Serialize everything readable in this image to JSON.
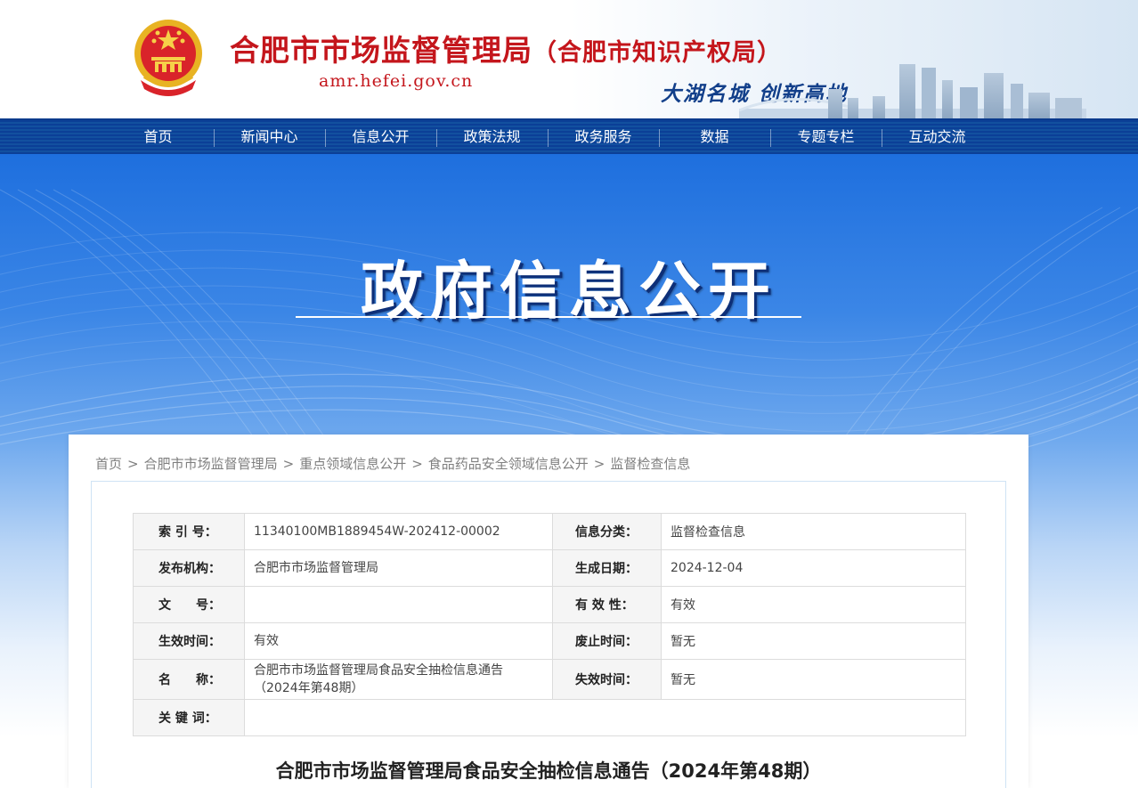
{
  "header": {
    "site_title_main": "合肥市市场监督管理局",
    "site_title_sub": "（合肥市知识产权局）",
    "domain": "amr.hefei.gov.cn",
    "slogan": "大湖名城 创新高地",
    "emblem_icon": "national-emblem-icon",
    "colors": {
      "title": "#c4161c",
      "slogan": "#123f8a"
    }
  },
  "nav": {
    "items": [
      {
        "label": "首页"
      },
      {
        "label": "新闻中心"
      },
      {
        "label": "信息公开"
      },
      {
        "label": "政策法规"
      },
      {
        "label": "政务服务"
      },
      {
        "label": "数据"
      },
      {
        "label": "专题专栏"
      },
      {
        "label": "互动交流"
      }
    ],
    "color": "#0b3f97"
  },
  "banner": {
    "title": "政府信息公开",
    "color": "#1e6fde"
  },
  "breadcrumb": {
    "items": [
      {
        "label": "首页"
      },
      {
        "label": "合肥市市场监督管理局"
      },
      {
        "label": "重点领域信息公开"
      },
      {
        "label": "食品药品安全领域信息公开"
      },
      {
        "label": "监督检查信息"
      }
    ],
    "separator": ">"
  },
  "meta_table": {
    "rows": [
      {
        "label1": "索 引 号：",
        "value1": "11340100MB1889454W-202412-00002",
        "label2": "信息分类：",
        "value2": "监督检查信息"
      },
      {
        "label1": "发布机构：",
        "value1": "合肥市市场监督管理局",
        "label2": "生成日期：",
        "value2": "2024-12-04"
      },
      {
        "label1": "文　　号：",
        "value1": "",
        "label2": "有 效 性：",
        "value2": "有效"
      },
      {
        "label1": "生效时间：",
        "value1": "有效",
        "label2": "废止时间：",
        "value2": "暂无"
      },
      {
        "label1": "名　　称：",
        "value1": "合肥市市场监督管理局食品安全抽检信息通告（2024年第48期）",
        "label2": "失效时间：",
        "value2": "暂无"
      },
      {
        "label1": "关 键 词：",
        "value1": ""
      }
    ]
  },
  "article": {
    "title": "合肥市市场监督管理局食品安全抽检信息通告（2024年第48期）"
  }
}
